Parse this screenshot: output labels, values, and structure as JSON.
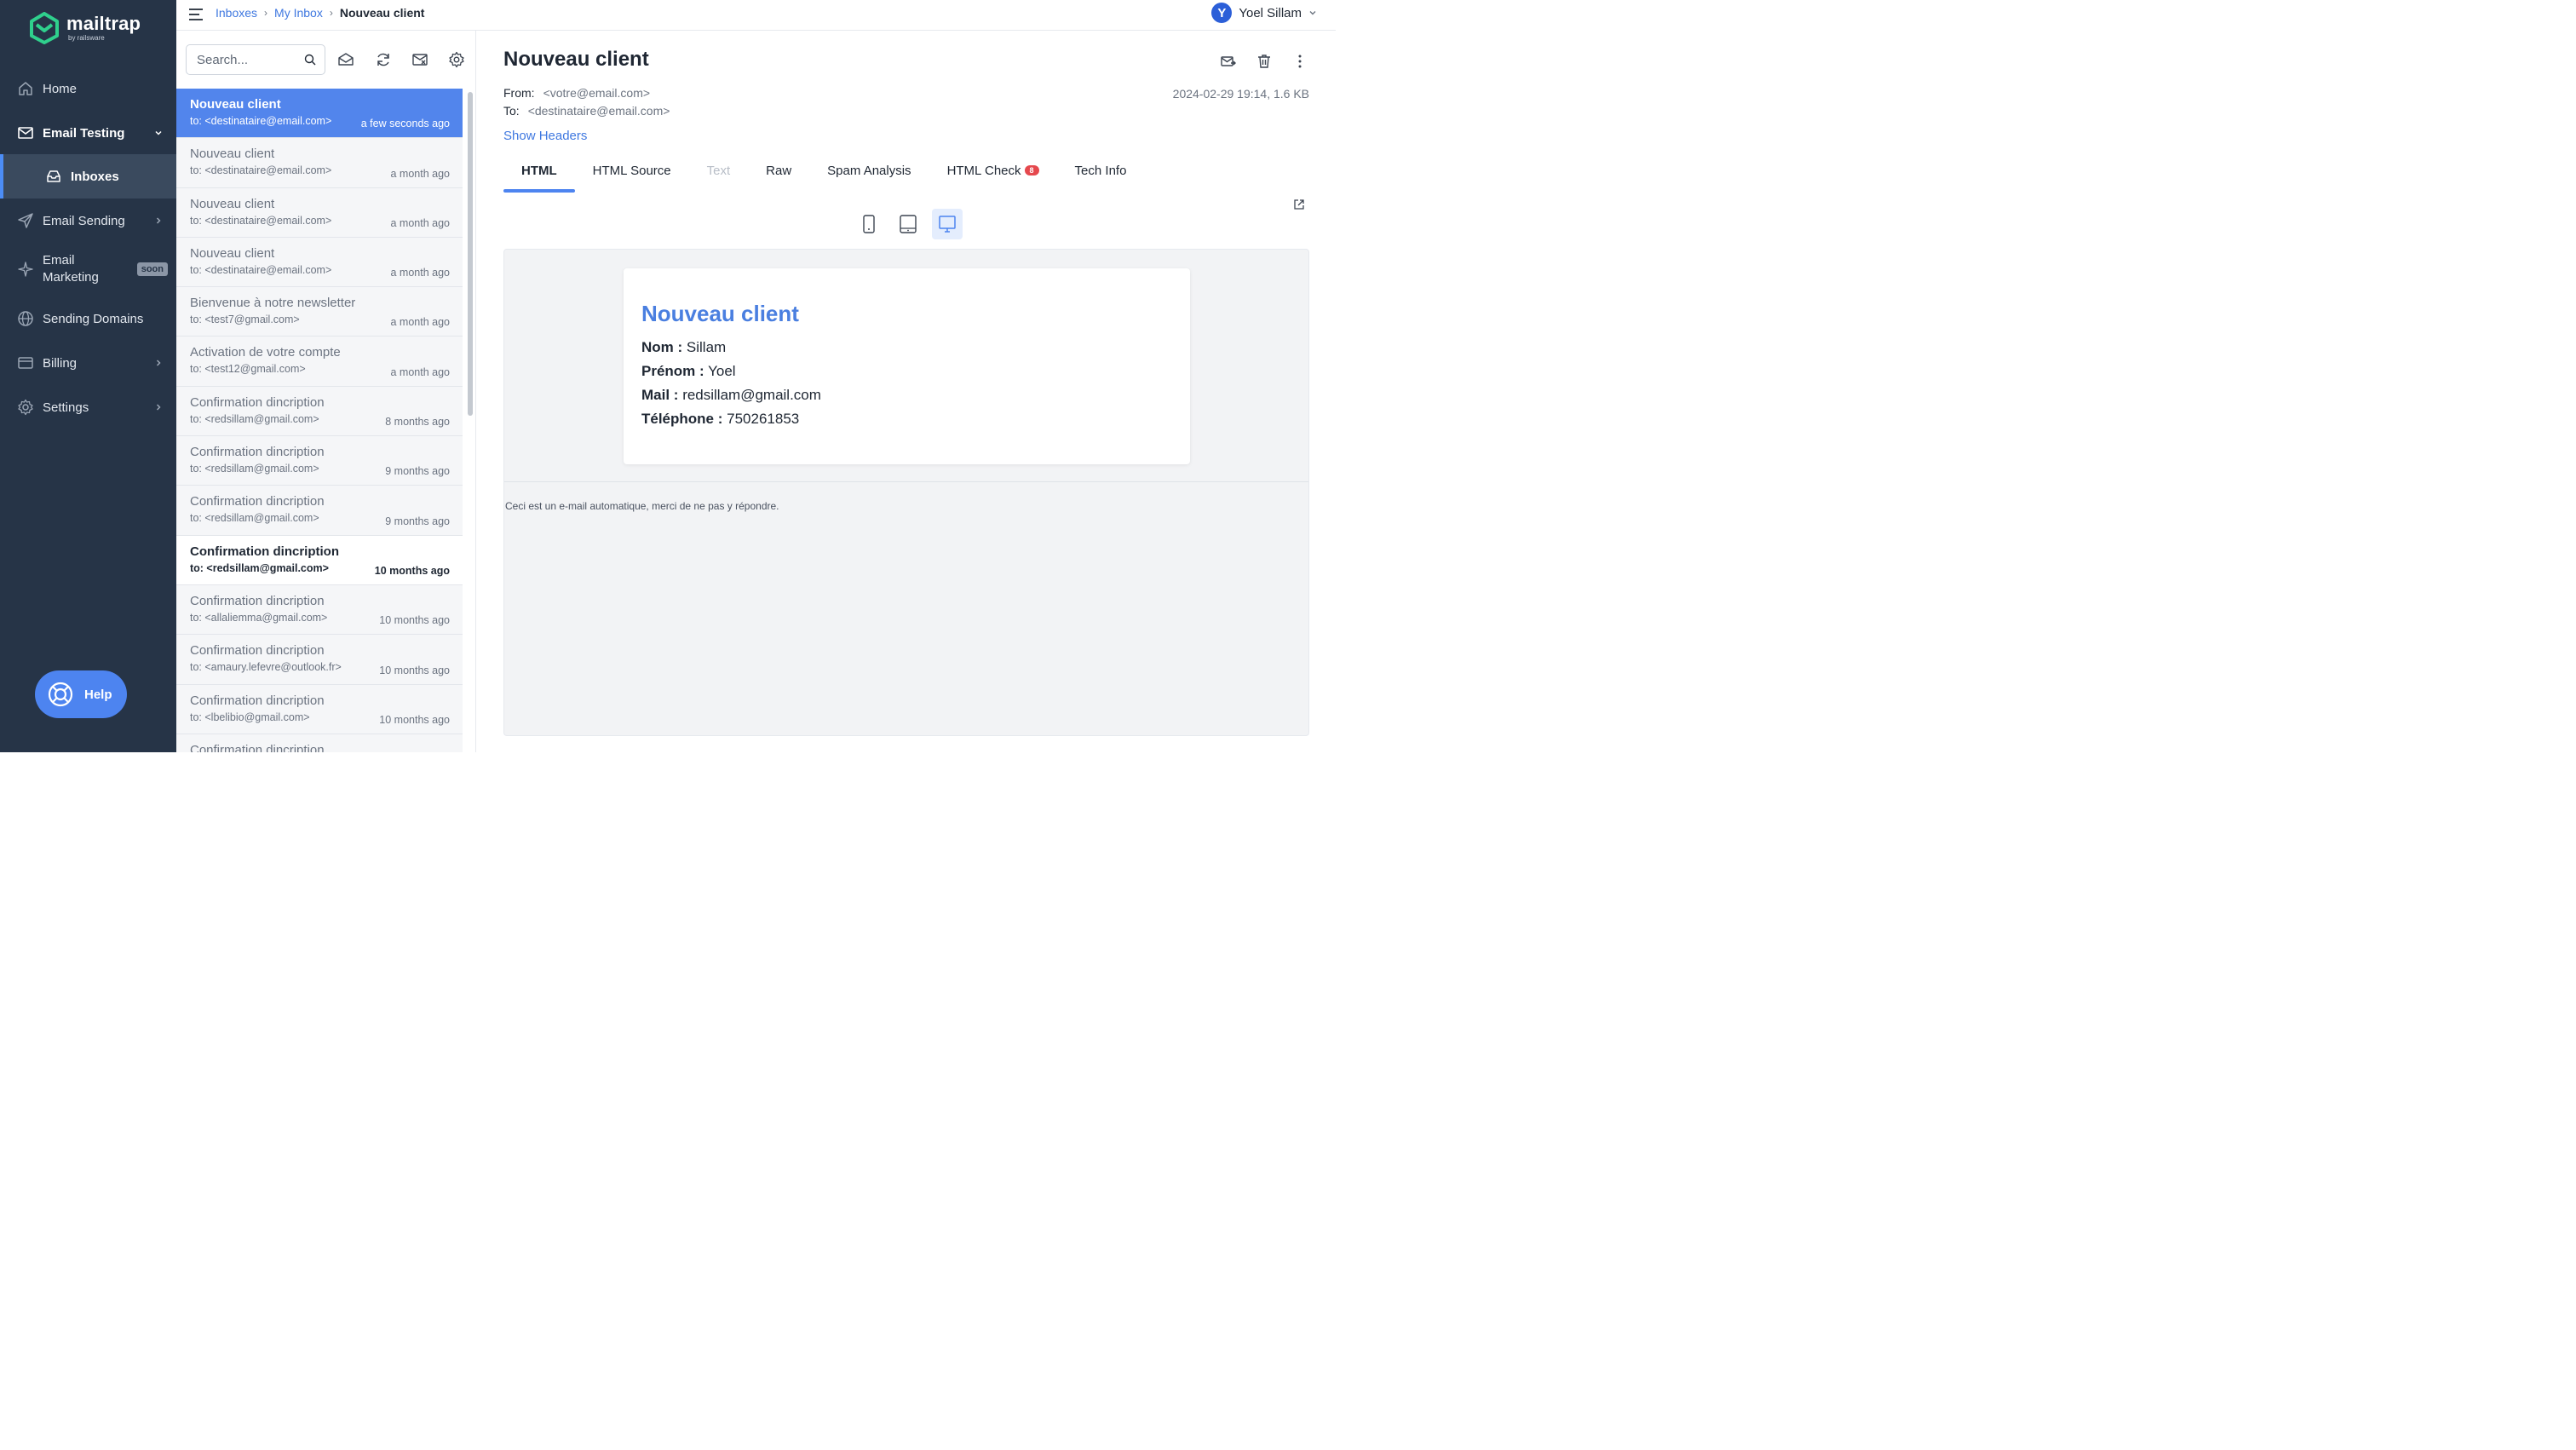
{
  "brand": {
    "name": "mailtrap",
    "sub": "by railsware"
  },
  "sidebar": {
    "items": [
      {
        "label": "Home"
      },
      {
        "label": "Email Testing"
      },
      {
        "label": "Inboxes"
      },
      {
        "label": "Email Sending"
      },
      {
        "label": "Email\nMarketing",
        "badge": "soon"
      },
      {
        "label": "Sending Domains"
      },
      {
        "label": "Billing"
      },
      {
        "label": "Settings"
      }
    ],
    "help": "Help"
  },
  "breadcrumb": {
    "a": "Inboxes",
    "b": "My Inbox",
    "current": "Nouveau client"
  },
  "user": {
    "initial": "Y",
    "name": "Yoel Sillam"
  },
  "search": {
    "placeholder": "Search..."
  },
  "messages": [
    {
      "subject": "Nouveau client",
      "to": "to: <destinataire@email.com>",
      "time": "a few seconds ago"
    },
    {
      "subject": "Nouveau client",
      "to": "to: <destinataire@email.com>",
      "time": "a month ago"
    },
    {
      "subject": "Nouveau client",
      "to": "to: <destinataire@email.com>",
      "time": "a month ago"
    },
    {
      "subject": "Nouveau client",
      "to": "to: <destinataire@email.com>",
      "time": "a month ago"
    },
    {
      "subject": "Bienvenue à notre newsletter",
      "to": "to: <test7@gmail.com>",
      "time": "a month ago"
    },
    {
      "subject": "Activation de votre compte",
      "to": "to: <test12@gmail.com>",
      "time": "a month ago"
    },
    {
      "subject": "Confirmation dincription",
      "to": "to: <redsillam@gmail.com>",
      "time": "8 months ago"
    },
    {
      "subject": "Confirmation dincription",
      "to": "to: <redsillam@gmail.com>",
      "time": "9 months ago"
    },
    {
      "subject": "Confirmation dincription",
      "to": "to: <redsillam@gmail.com>",
      "time": "9 months ago"
    },
    {
      "subject": "Confirmation dincription",
      "to": "to: <redsillam@gmail.com>",
      "time": "10 months ago"
    },
    {
      "subject": "Confirmation dincription",
      "to": "to: <allaliemma@gmail.com>",
      "time": "10 months ago"
    },
    {
      "subject": "Confirmation dincription",
      "to": "to: <amaury.lefevre@outlook.fr>",
      "time": "10 months ago"
    },
    {
      "subject": "Confirmation dincription",
      "to": "to: <lbelibio@gmail.com>",
      "time": "10 months ago"
    },
    {
      "subject": "Confirmation dincription",
      "to": "",
      "time": ""
    }
  ],
  "detail": {
    "title": "Nouveau client",
    "from_label": "From:",
    "from": "<votre@email.com>",
    "to_label": "To:",
    "to": "<destinataire@email.com>",
    "meta": "2024-02-29 19:14, 1.6 KB",
    "show_headers": "Show Headers",
    "tabs": [
      "HTML",
      "HTML Source",
      "Text",
      "Raw",
      "Spam Analysis",
      "HTML Check",
      "Tech Info"
    ],
    "html_check_badge": "8"
  },
  "email": {
    "heading": "Nouveau client",
    "fields": [
      {
        "label": "Nom :",
        "value": "Sillam"
      },
      {
        "label": "Prénom :",
        "value": "Yoel"
      },
      {
        "label": "Mail :",
        "value": "redsillam@gmail.com"
      },
      {
        "label": "Téléphone :",
        "value": "750261853"
      }
    ],
    "footer": "Ceci est un e-mail automatique, merci de ne pas y répondre."
  }
}
